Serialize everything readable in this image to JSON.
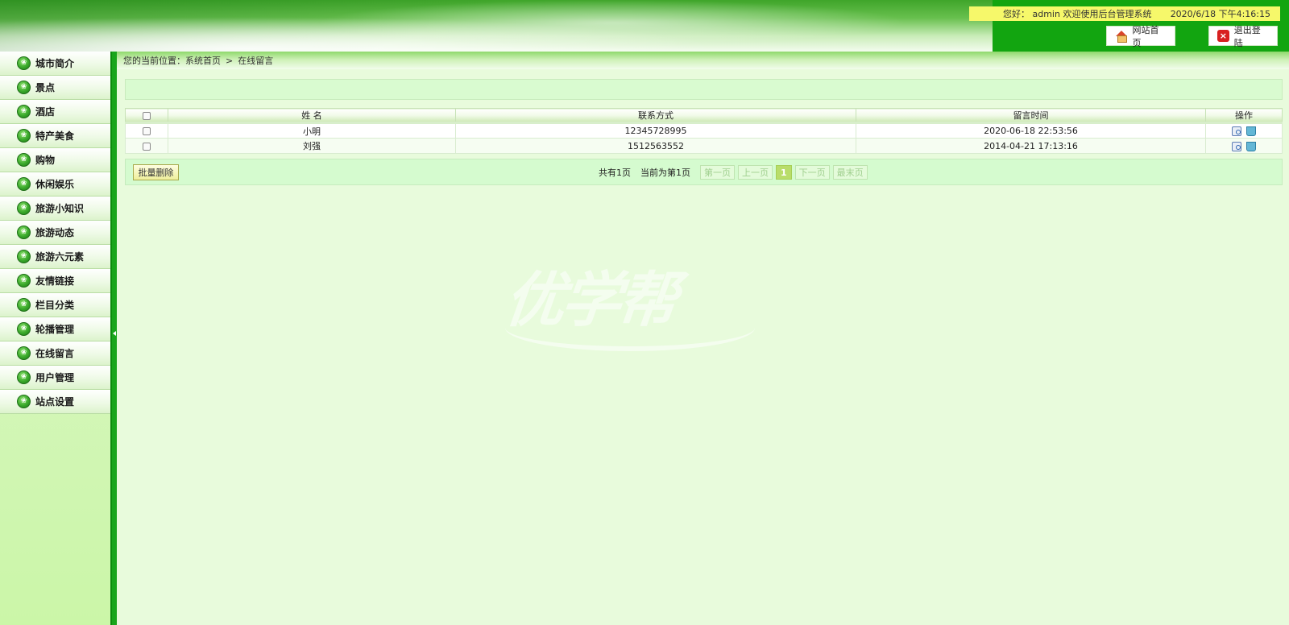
{
  "header": {
    "welcome_text": "您好： admin 欢迎使用后台管理系统",
    "datetime": "2020/6/18 下午4:16:15",
    "home_button": "网站首页",
    "logout_button": "退出登陆"
  },
  "sidebar": {
    "items": [
      {
        "label": "城市简介"
      },
      {
        "label": "景点"
      },
      {
        "label": "酒店"
      },
      {
        "label": "特产美食"
      },
      {
        "label": "购物"
      },
      {
        "label": "休闲娱乐"
      },
      {
        "label": "旅游小知识"
      },
      {
        "label": "旅游动态"
      },
      {
        "label": "旅游六元素"
      },
      {
        "label": "友情链接"
      },
      {
        "label": "栏目分类"
      },
      {
        "label": "轮播管理"
      },
      {
        "label": "在线留言"
      },
      {
        "label": "用户管理"
      },
      {
        "label": "站点设置"
      }
    ]
  },
  "breadcrumb": {
    "prefix": "您的当前位置：",
    "home": "系统首页",
    "separator": ">",
    "current": "在线留言"
  },
  "table": {
    "columns": [
      "姓 名",
      "联系方式",
      "留言时间",
      "操作"
    ],
    "rows": [
      {
        "name": "小明",
        "contact": "12345728995",
        "time": "2020-06-18 22:53:56"
      },
      {
        "name": "刘强",
        "contact": "1512563552",
        "time": "2014-04-21 17:13:16"
      }
    ]
  },
  "pager": {
    "batch_delete": "批量删除",
    "total_pages": "共有1页",
    "current_page_text": "当前为第1页",
    "first": "第一页",
    "prev": "上一页",
    "current": "1",
    "next": "下一页",
    "last": "最末页"
  },
  "watermark": {
    "text": "优学帮"
  },
  "colors": {
    "header_panel": "#12a510",
    "welcome_bar": "#f6f86a",
    "splitter": "#19a51b",
    "page_bg": "#e8fbdc"
  }
}
